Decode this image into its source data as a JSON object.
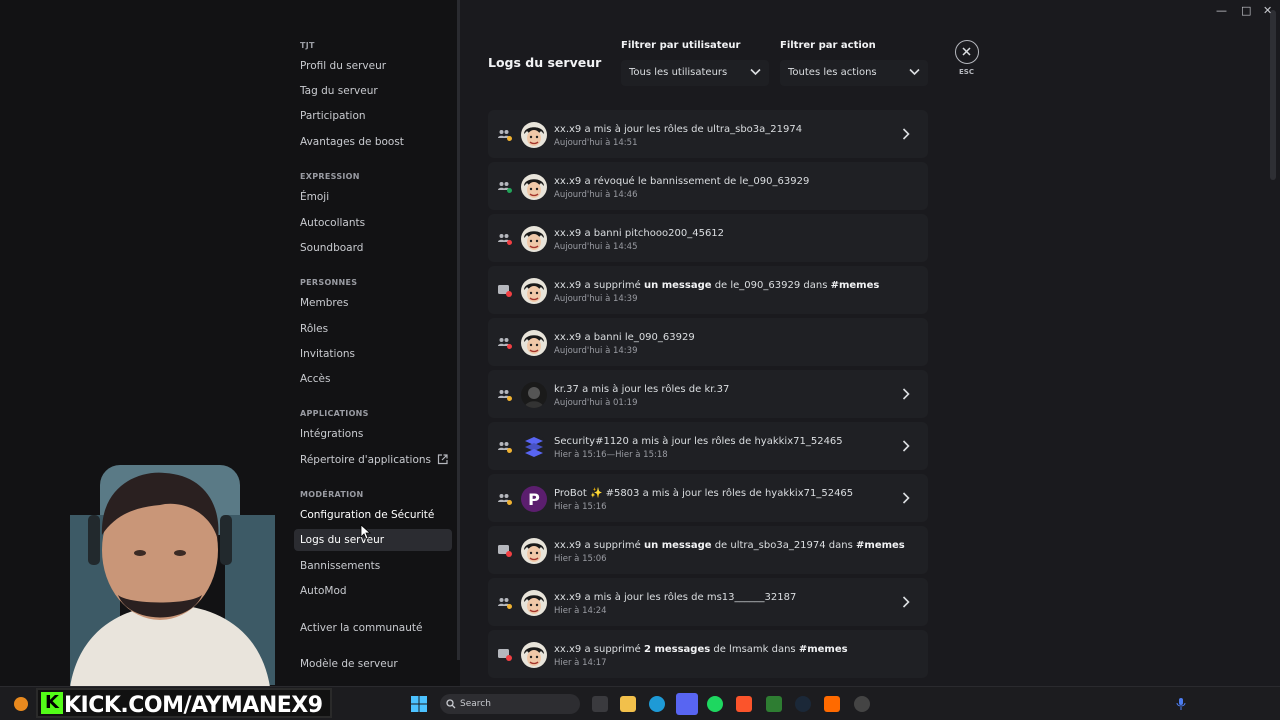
{
  "sidebar": {
    "server_name": "TJT",
    "server_items": [
      "Profil du serveur",
      "Tag du serveur",
      "Participation",
      "Avantages de boost"
    ],
    "expression_title": "EXPRESSION",
    "expression_items": [
      "Émoji",
      "Autocollants",
      "Soundboard"
    ],
    "people_title": "PERSONNES",
    "people_items": [
      "Membres",
      "Rôles",
      "Invitations",
      "Accès"
    ],
    "apps_title": "APPLICATIONS",
    "apps_items": [
      "Intégrations",
      "Répertoire d'applications"
    ],
    "moderation_title": "MODÉRATION",
    "moderation_items": [
      "Configuration de Sécurité",
      "Logs du serveur",
      "Bannissements",
      "AutoMod"
    ],
    "community_items": [
      "Activer la communauté",
      "Modèle de serveur"
    ]
  },
  "header": {
    "title": "Logs du serveur",
    "filter_user_label": "Filtrer par utilisateur",
    "filter_user_value": "Tous les utilisateurs",
    "filter_action_label": "Filtrer par action",
    "filter_action_value": "Toutes les actions",
    "esc_label": "ESC"
  },
  "logs": [
    {
      "pre": "xx.x9 a mis à jour les rôles de ultra_sbo3a_21974",
      "bold": "",
      "post": "",
      "bold2": "",
      "time": "Aujourd'hui à 14:51",
      "type": "role",
      "avatar": "face",
      "chevron": true
    },
    {
      "pre": "xx.x9 a révoqué le bannissement de le_090_63929",
      "bold": "",
      "post": "",
      "bold2": "",
      "time": "Aujourd'hui à 14:46",
      "type": "unban",
      "avatar": "face",
      "chevron": false
    },
    {
      "pre": "xx.x9 a banni pitchooo200_45612",
      "bold": "",
      "post": "",
      "bold2": "",
      "time": "Aujourd'hui à 14:45",
      "type": "ban",
      "avatar": "face",
      "chevron": false
    },
    {
      "pre": "xx.x9 a supprimé ",
      "bold": "un message",
      "post": " de le_090_63929 dans ",
      "bold2": "#memes",
      "time": "Aujourd'hui à 14:39",
      "type": "message",
      "avatar": "face",
      "chevron": false
    },
    {
      "pre": "xx.x9 a banni le_090_63929",
      "bold": "",
      "post": "",
      "bold2": "",
      "time": "Aujourd'hui à 14:39",
      "type": "ban",
      "avatar": "face",
      "chevron": false
    },
    {
      "pre": "kr.37 a mis à jour les rôles de kr.37",
      "bold": "",
      "post": "",
      "bold2": "",
      "time": "Aujourd'hui à 01:19",
      "type": "role",
      "avatar": "dark",
      "chevron": true
    },
    {
      "pre": "Security",
      "bold": "",
      "post": "#1120 a mis à jour les rôles de hyakkix71_52465",
      "bold2": "",
      "time": "Hier à 15:16—Hier à 15:18",
      "type": "role",
      "avatar": "security",
      "chevron": true
    },
    {
      "pre": "ProBot ✨ ",
      "bold": "",
      "post": "#5803 a mis à jour les rôles de hyakkix71_52465",
      "bold2": "",
      "time": "Hier à 15:16",
      "type": "role",
      "avatar": "probot",
      "chevron": true
    },
    {
      "pre": "xx.x9 a supprimé ",
      "bold": "un message",
      "post": " de ultra_sbo3a_21974 dans ",
      "bold2": "#memes",
      "time": "Hier à 15:06",
      "type": "message",
      "avatar": "face",
      "chevron": false
    },
    {
      "pre": "xx.x9 a mis à jour les rôles de ms13______32187",
      "bold": "",
      "post": "",
      "bold2": "",
      "time": "Hier à 14:24",
      "type": "role",
      "avatar": "face",
      "chevron": true
    },
    {
      "pre": "xx.x9 a supprimé ",
      "bold": "2 messages",
      "post": " de lmsamk dans ",
      "bold2": "#memes",
      "time": "Hier à 14:17",
      "type": "message",
      "avatar": "face",
      "chevron": false
    }
  ],
  "stream": {
    "banner_text": "KICK.COM/AYMANEX9"
  },
  "taskbar": {
    "search_placeholder": "Search"
  },
  "colors": {
    "accent_green": "#53fc18",
    "discord_blurple": "#5865f2",
    "role_yellow": "#f0b232",
    "ban_red": "#f23f43",
    "unban_green": "#23a55a"
  }
}
